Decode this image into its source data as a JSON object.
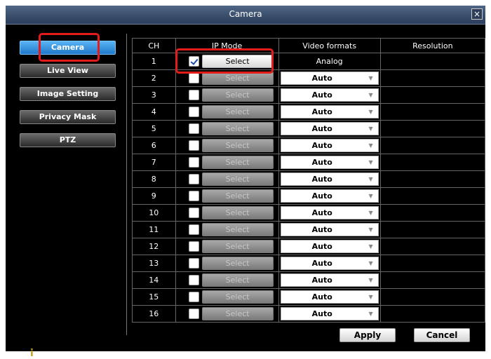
{
  "window": {
    "title": "Camera",
    "close_icon": "×"
  },
  "sidebar": {
    "items": [
      {
        "label": "Camera",
        "active": true
      },
      {
        "label": "Live View",
        "active": false
      },
      {
        "label": "Image Setting",
        "active": false
      },
      {
        "label": "Privacy Mask",
        "active": false
      },
      {
        "label": "PTZ",
        "active": false
      }
    ]
  },
  "table": {
    "headers": {
      "ch": "CH",
      "ip_mode": "IP Mode",
      "video_formats": "Video formats",
      "resolution": "Resolution"
    },
    "rows": [
      {
        "ch": "1",
        "checked": true,
        "select_label": "Select",
        "select_enabled": true,
        "format": "Analog",
        "format_type": "text",
        "resolution": ""
      },
      {
        "ch": "2",
        "checked": false,
        "select_label": "Select",
        "select_enabled": false,
        "format": "Auto",
        "format_type": "dropdown",
        "resolution": ""
      },
      {
        "ch": "3",
        "checked": false,
        "select_label": "Select",
        "select_enabled": false,
        "format": "Auto",
        "format_type": "dropdown",
        "resolution": ""
      },
      {
        "ch": "4",
        "checked": false,
        "select_label": "Select",
        "select_enabled": false,
        "format": "Auto",
        "format_type": "dropdown",
        "resolution": ""
      },
      {
        "ch": "5",
        "checked": false,
        "select_label": "Select",
        "select_enabled": false,
        "format": "Auto",
        "format_type": "dropdown",
        "resolution": ""
      },
      {
        "ch": "6",
        "checked": false,
        "select_label": "Select",
        "select_enabled": false,
        "format": "Auto",
        "format_type": "dropdown",
        "resolution": ""
      },
      {
        "ch": "7",
        "checked": false,
        "select_label": "Select",
        "select_enabled": false,
        "format": "Auto",
        "format_type": "dropdown",
        "resolution": ""
      },
      {
        "ch": "8",
        "checked": false,
        "select_label": "Select",
        "select_enabled": false,
        "format": "Auto",
        "format_type": "dropdown",
        "resolution": ""
      },
      {
        "ch": "9",
        "checked": false,
        "select_label": "Select",
        "select_enabled": false,
        "format": "Auto",
        "format_type": "dropdown",
        "resolution": ""
      },
      {
        "ch": "10",
        "checked": false,
        "select_label": "Select",
        "select_enabled": false,
        "format": "Auto",
        "format_type": "dropdown",
        "resolution": ""
      },
      {
        "ch": "11",
        "checked": false,
        "select_label": "Select",
        "select_enabled": false,
        "format": "Auto",
        "format_type": "dropdown",
        "resolution": ""
      },
      {
        "ch": "12",
        "checked": false,
        "select_label": "Select",
        "select_enabled": false,
        "format": "Auto",
        "format_type": "dropdown",
        "resolution": ""
      },
      {
        "ch": "13",
        "checked": false,
        "select_label": "Select",
        "select_enabled": false,
        "format": "Auto",
        "format_type": "dropdown",
        "resolution": ""
      },
      {
        "ch": "14",
        "checked": false,
        "select_label": "Select",
        "select_enabled": false,
        "format": "Auto",
        "format_type": "dropdown",
        "resolution": ""
      },
      {
        "ch": "15",
        "checked": false,
        "select_label": "Select",
        "select_enabled": false,
        "format": "Auto",
        "format_type": "dropdown",
        "resolution": ""
      },
      {
        "ch": "16",
        "checked": false,
        "select_label": "Select",
        "select_enabled": false,
        "format": "Auto",
        "format_type": "dropdown",
        "resolution": ""
      }
    ]
  },
  "actions": {
    "apply_label": "Apply",
    "cancel_label": "Cancel"
  },
  "footer": {
    "mark": "i"
  },
  "colors": {
    "highlight": "#e41b1b",
    "active_tab": "#2a8ae0",
    "titlebar": "#3a4f6e"
  },
  "icons": {
    "close": "close-icon",
    "check": "checkmark-icon",
    "dropdown": "dropdown-arrow-icon"
  }
}
